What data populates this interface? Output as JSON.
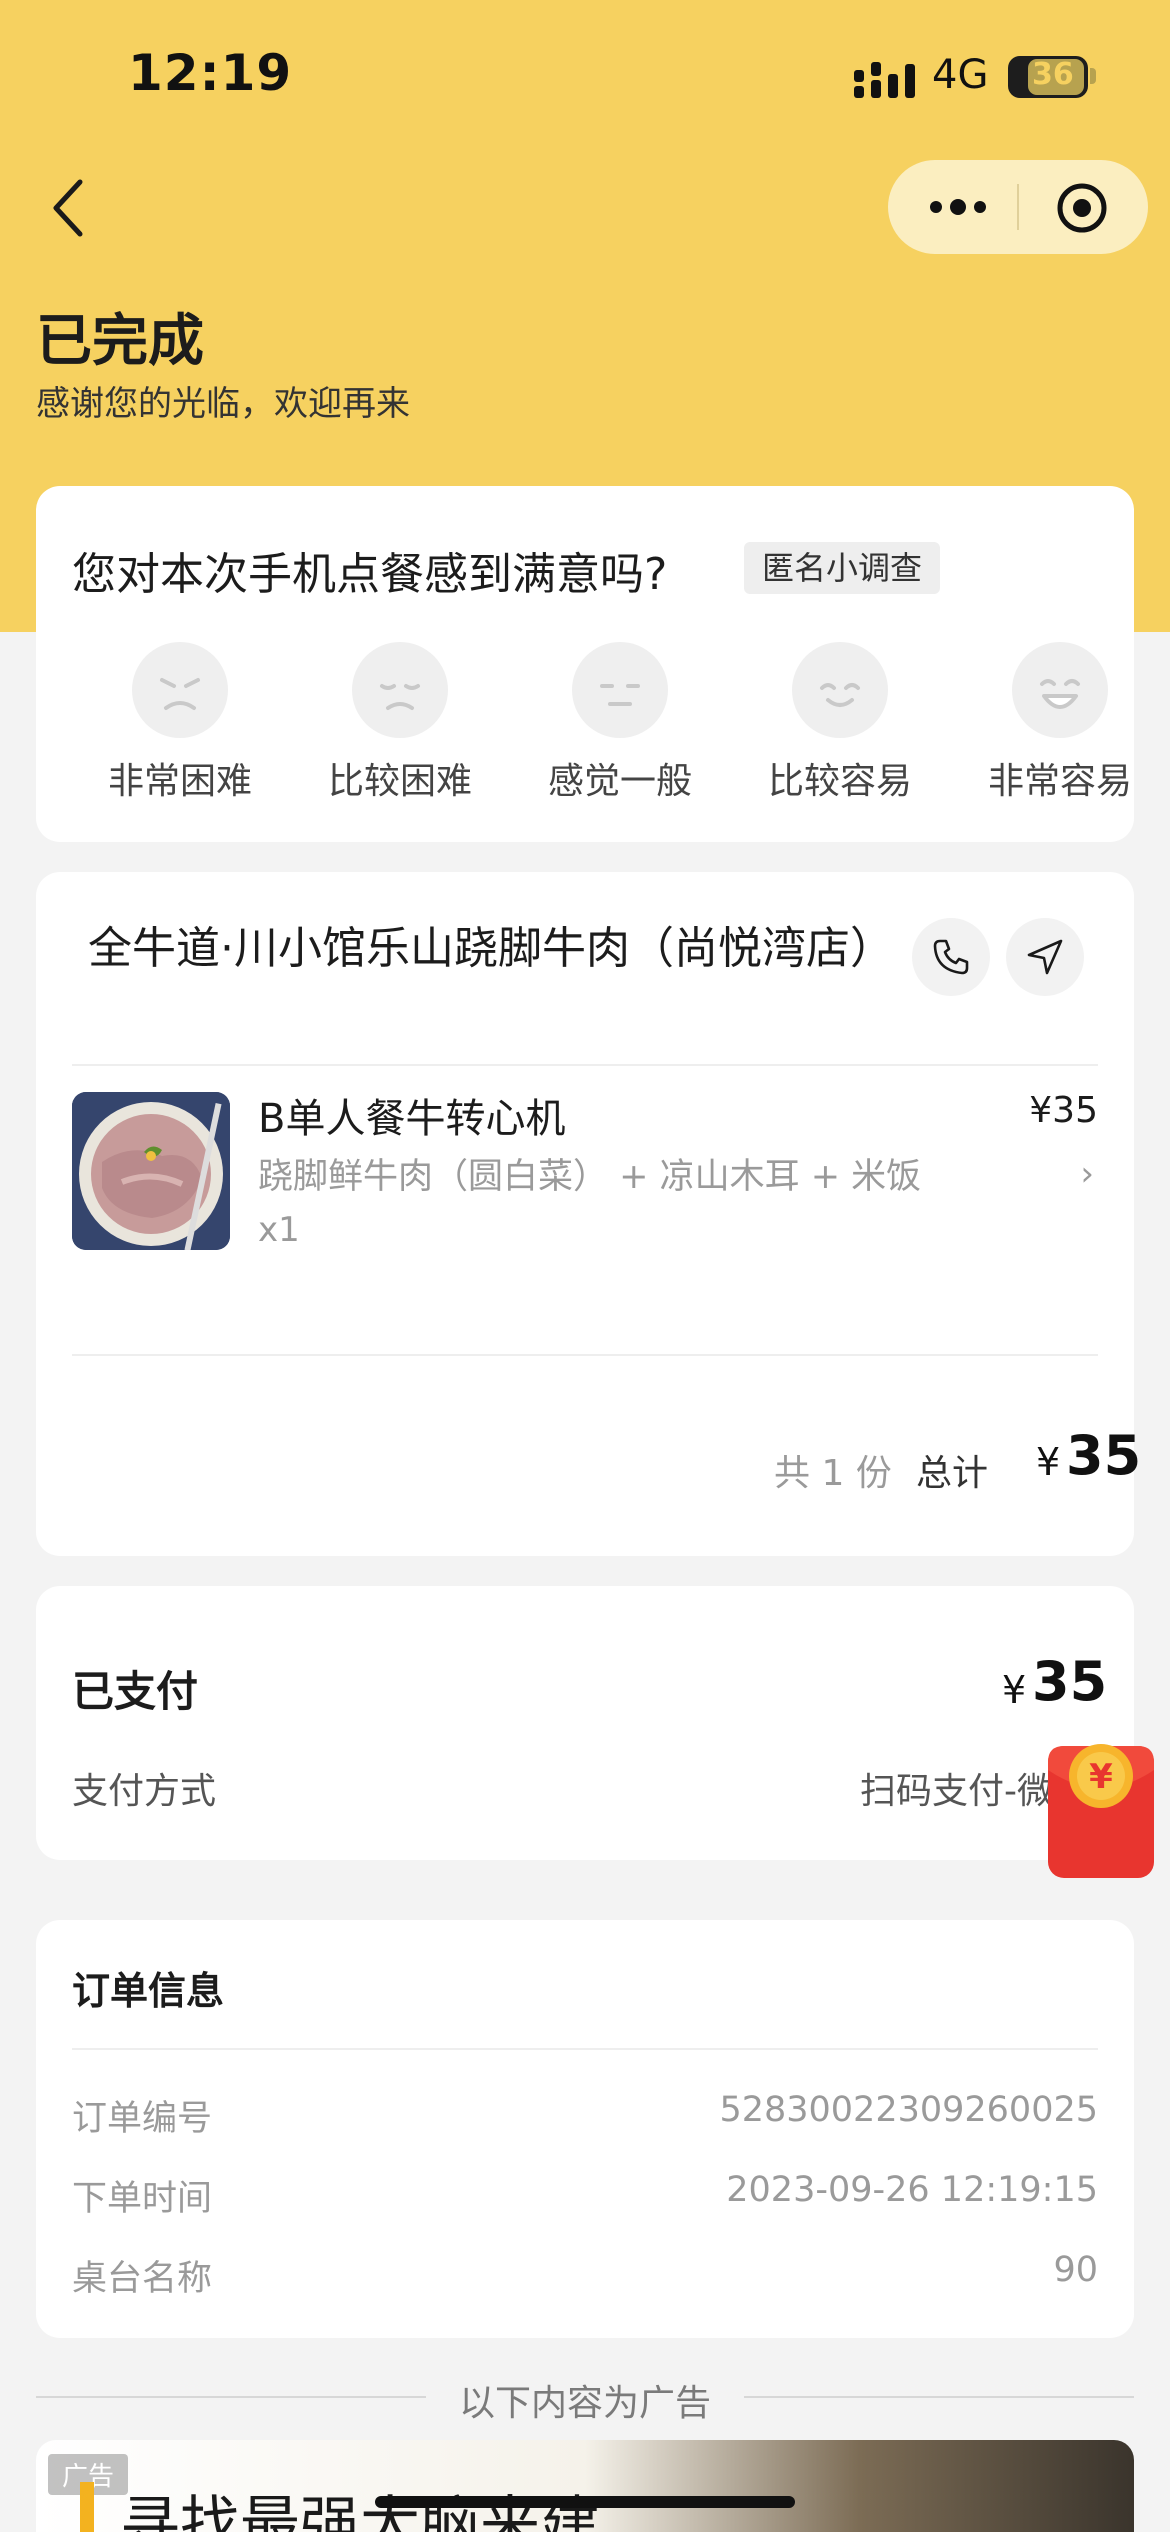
{
  "status_bar": {
    "time": "12:19",
    "network": "4G",
    "battery": "36"
  },
  "order_status": {
    "title": "已完成",
    "subtitle": "感谢您的光临，欢迎再来"
  },
  "survey": {
    "question": "您对本次手机点餐感到满意吗?",
    "badge": "匿名小调查",
    "options": [
      {
        "label": "非常困难",
        "icon": "very-difficult-face-icon"
      },
      {
        "label": "比较困难",
        "icon": "difficult-face-icon"
      },
      {
        "label": "感觉一般",
        "icon": "neutral-face-icon"
      },
      {
        "label": "比较容易",
        "icon": "easy-face-icon"
      },
      {
        "label": "非常容易",
        "icon": "very-easy-face-icon"
      }
    ]
  },
  "order": {
    "shop_name": "全牛道·川小馆乐山跷脚牛肉（尚悦湾店）",
    "item": {
      "name": "B单人餐牛转心机",
      "price": "¥35",
      "description": "跷脚鲜牛肉（圆白菜） + 凉山木耳 + 米饭",
      "quantity": "x1"
    },
    "count_text": "共 1 份",
    "total_label": "总计",
    "currency": "¥",
    "total_amount": "35"
  },
  "payment": {
    "paid_label": "已支付",
    "currency": "¥",
    "paid_amount": "35",
    "method_label": "支付方式",
    "method_value": "扫码支付-微信支付"
  },
  "order_info": {
    "title": "订单信息",
    "rows": [
      {
        "key": "订单编号",
        "value": "52830022309260025"
      },
      {
        "key": "下单时间",
        "value": "2023-09-26 12:19:15"
      },
      {
        "key": "桌台名称",
        "value": "90"
      }
    ]
  },
  "ad": {
    "divider_text": "以下内容为广告",
    "tag": "广告",
    "headline": "寻找最强大脑来建"
  },
  "colors": {
    "header_bg": "#f6d160",
    "page_bg": "#f3f3f3",
    "red_packet": "#e8352f"
  }
}
